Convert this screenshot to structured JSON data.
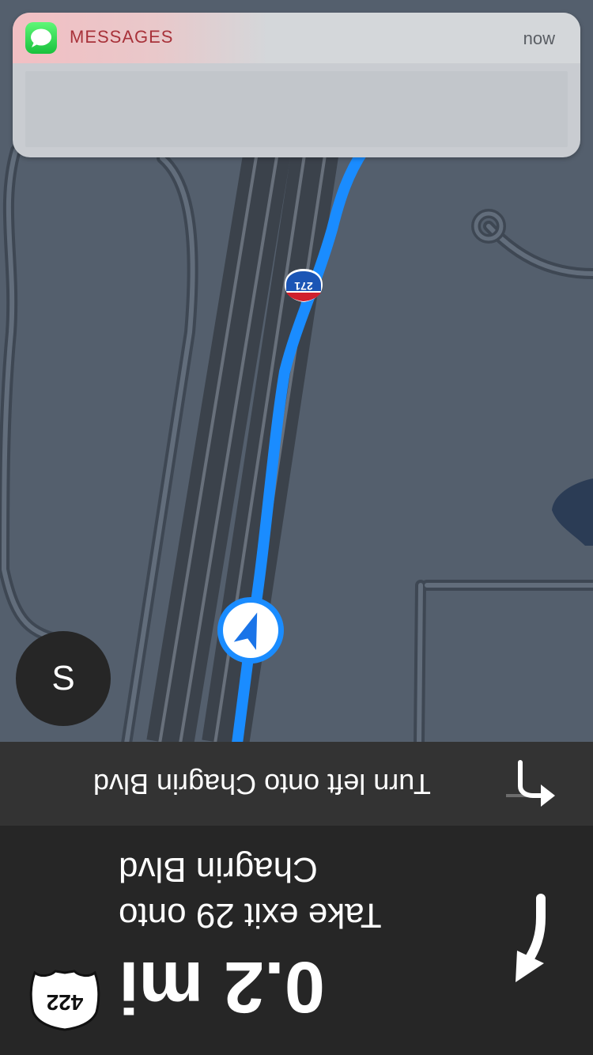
{
  "notification": {
    "app_name": "MESSAGES",
    "time": "now",
    "app_icon": "messages-icon"
  },
  "map": {
    "route_shield": "271",
    "compass_label": "S",
    "location_icon": "navigation-arrow-icon"
  },
  "next_maneuver": {
    "text": "Turn left onto Chagrin Blvd",
    "icon": "turn-left-icon"
  },
  "current_maneuver": {
    "distance": "0.2 mi",
    "instruction": "Take exit 29 onto Chagrin Blvd",
    "icon": "exit-right-arrow-icon",
    "route_shield": "422"
  },
  "colors": {
    "map_background": "#545f6d",
    "route": "#1a8cff",
    "panel": "#262626"
  }
}
